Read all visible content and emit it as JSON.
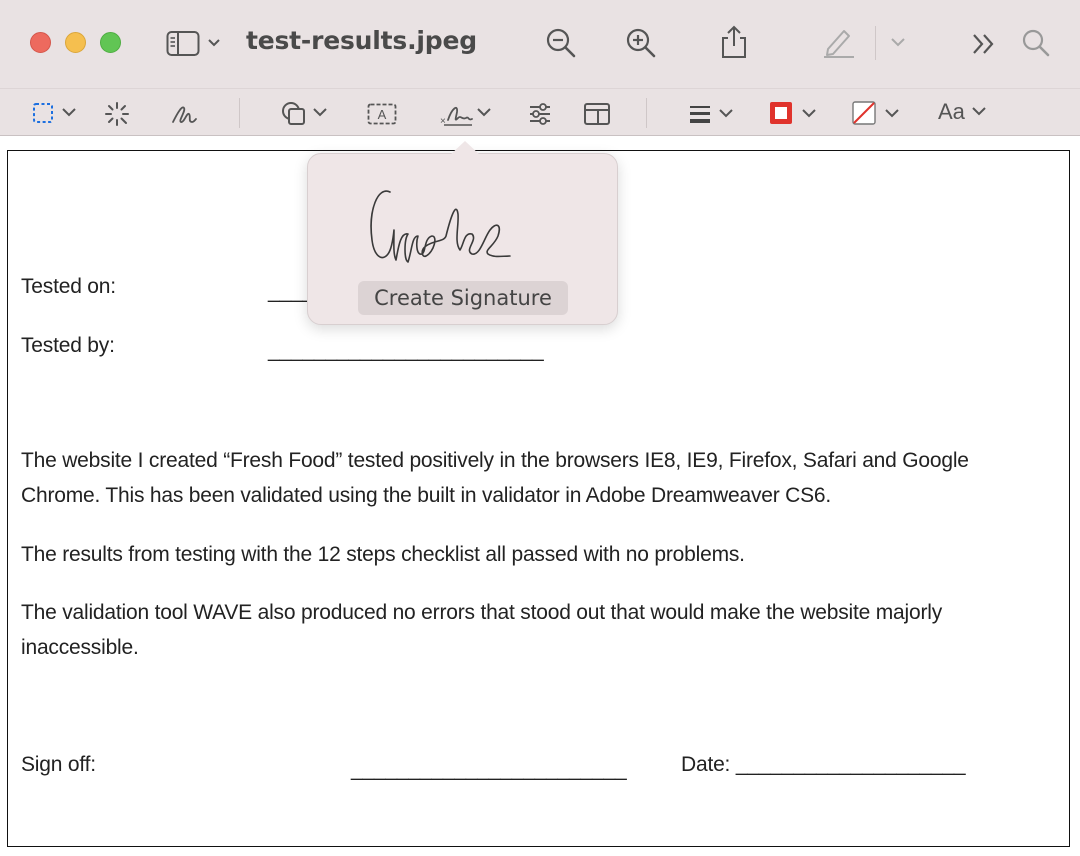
{
  "window": {
    "title": "test-results.jpeg",
    "icons": [
      "sidebar-icon",
      "zoom-out-icon",
      "zoom-in-icon",
      "share-icon",
      "markup-pen-icon",
      "more-icon",
      "search-icon"
    ]
  },
  "toolbar": {
    "tools": [
      "rect-select-icon",
      "instant-alpha-icon",
      "sketch-icon",
      "shapes-icon",
      "text-box-icon",
      "signature-icon",
      "adjust-color-icon",
      "page-layout-icon",
      "line-style-icon",
      "border-color-icon",
      "fill-color-icon"
    ],
    "text_style_label": "Aa",
    "colors": {
      "border": "#e0332c",
      "fill_slash": "#e0332c"
    }
  },
  "popover": {
    "button_label": "Create Signature",
    "signature_name": "signature-sample"
  },
  "document": {
    "tested_on_label": "Tested on:",
    "tested_on_line": "_______",
    "tested_by_label": "Tested by:",
    "tested_by_line": "________________________",
    "paragraph1": "The website I created “Fresh Food” tested positively in the browsers IE8, IE9, Firefox, Safari and Google Chrome. This has been validated using the built in validator in Adobe Dreamweaver CS6.",
    "paragraph2": "The results from testing with the 12 steps checklist all passed with no problems.",
    "paragraph3": "The validation tool WAVE also produced no errors that stood out that would make the website majorly inaccessible.",
    "sign_off_label": "Sign off:",
    "sign_off_line": "________________________",
    "date_label": "Date: ____________________"
  }
}
